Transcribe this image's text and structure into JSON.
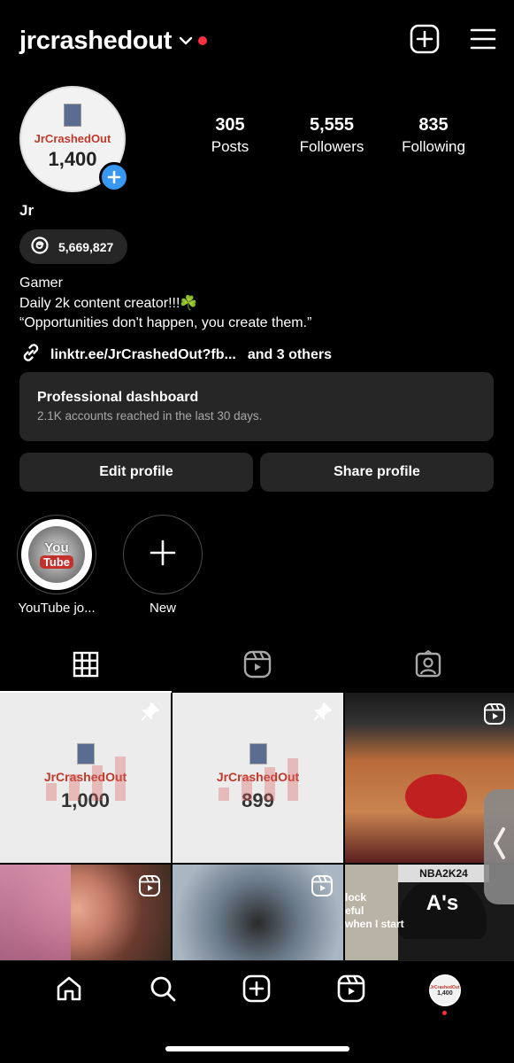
{
  "header": {
    "username": "jrcrashedout",
    "notification_dot_color": "#ff3040"
  },
  "profile": {
    "avatar_title": "JrCrashedOut",
    "avatar_count": "1,400",
    "display_name": "Jr",
    "threads_count": "5,669,827"
  },
  "stats": [
    {
      "value": "305",
      "label": "Posts"
    },
    {
      "value": "5,555",
      "label": "Followers"
    },
    {
      "value": "835",
      "label": "Following"
    }
  ],
  "bio": {
    "line1": "Gamer",
    "line2": "Daily 2k content creator!!!☘️",
    "line3": "“Opportunities don't happen, you create them.”"
  },
  "link": {
    "url": "linktr.ee/JrCrashedOut?fb...",
    "others": "and 3 others"
  },
  "dashboard": {
    "title": "Professional dashboard",
    "subtitle": "2.1K accounts reached in the last 30 days."
  },
  "buttons": {
    "edit": "Edit profile",
    "share": "Share profile"
  },
  "highlights": [
    {
      "label": "YouTube jo...",
      "you": "You",
      "tube": "Tube"
    },
    {
      "label": "New"
    }
  ],
  "grid": {
    "post1": {
      "title": "JrCrashedOut",
      "count": "1,000"
    },
    "post2": {
      "title": "JrCrashedOut",
      "count": "899"
    },
    "post6": {
      "ribbon": "NBA2K24",
      "hat": "A's",
      "text1": "lock",
      "text2": "eful",
      "text3": "when I start"
    }
  },
  "bottom_nav": {
    "avatar_title": "JrCrashedOut",
    "avatar_count": "1,400"
  },
  "colors": {
    "accent_blue": "#3897f0",
    "surface": "#262626",
    "brand_red": "#c0392b"
  }
}
